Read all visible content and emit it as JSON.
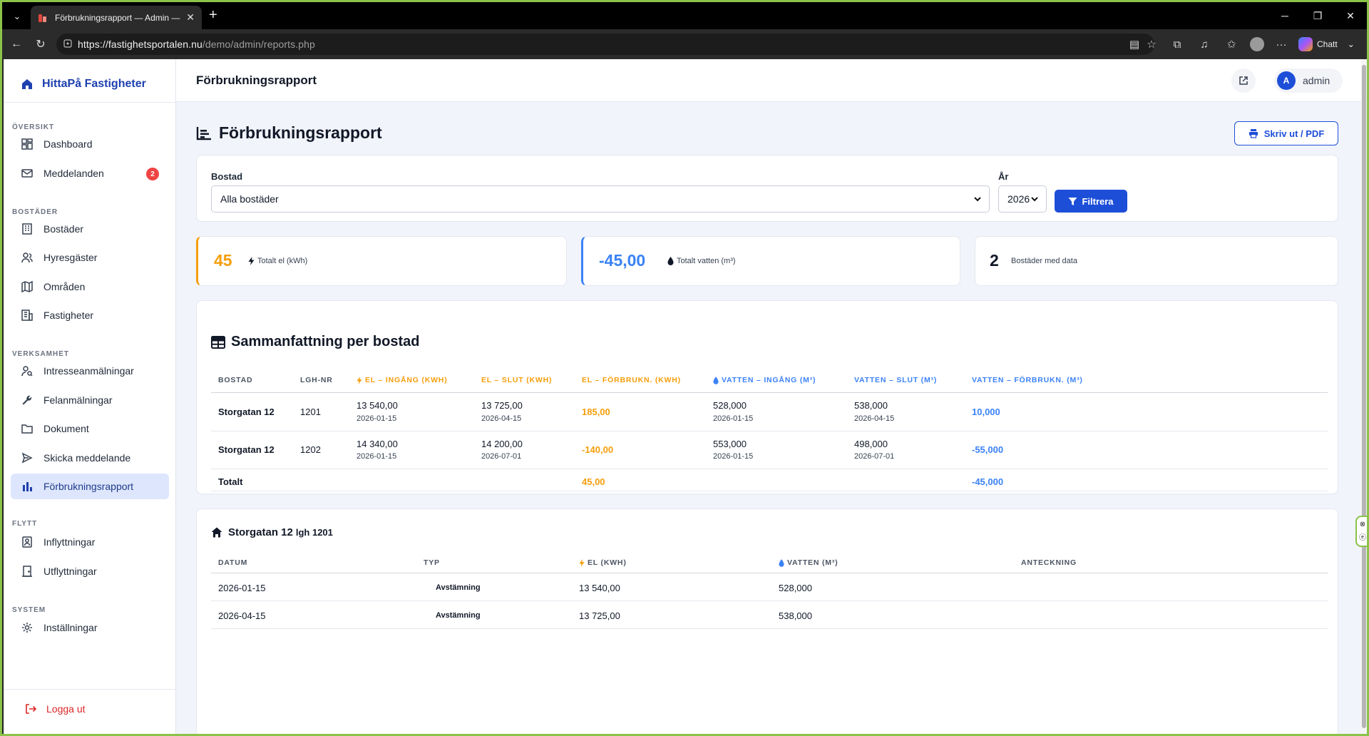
{
  "browser": {
    "tab_title": "Förbrukningsrapport — Admin —",
    "url_host": "https://fastighetsportalen.nu",
    "url_path": "/demo/admin/reports.php",
    "copilot_label": "Chatt"
  },
  "sidebar": {
    "brand": "HittaPå Fastigheter",
    "sections": {
      "overview": "ÖVERSIKT",
      "properties": "BOSTÄDER",
      "operations": "VERKSAMHET",
      "moving": "FLYTT",
      "system": "SYSTEM"
    },
    "items": {
      "dashboard": "Dashboard",
      "messages": "Meddelanden",
      "messages_badge": "2",
      "units": "Bostäder",
      "tenants": "Hyresgäster",
      "areas": "Områden",
      "buildings": "Fastigheter",
      "interest": "Intresseanmälningar",
      "fault_reports": "Felanmälningar",
      "documents": "Dokument",
      "send_message": "Skicka meddelande",
      "consumption_report": "Förbrukningsrapport",
      "move_ins": "Inflyttningar",
      "move_outs": "Utflyttningar",
      "settings": "Inställningar"
    },
    "logout": "Logga ut"
  },
  "header": {
    "title": "Förbrukningsrapport",
    "user_initial": "A",
    "user_name": "admin"
  },
  "page": {
    "title": "Förbrukningsrapport",
    "print_button": "Skriv ut / PDF"
  },
  "filter": {
    "unit_label": "Bostad",
    "unit_value": "Alla bostäder",
    "year_label": "År",
    "year_value": "2026",
    "filter_button": "Filtrera"
  },
  "stats": {
    "electricity_value": "45",
    "electricity_label": "Totalt el (kWh)",
    "water_value": "-45,00",
    "water_label": "Totalt vatten (m³)",
    "units_value": "2",
    "units_label": "Bostäder med data",
    "electricity_color": "#f59e0b",
    "water_color": "#3b82f6"
  },
  "summary": {
    "title": "Sammanfattning per bostad",
    "headers": {
      "unit": "BOSTAD",
      "apt_no": "LGH-NR",
      "el_in": "EL – INGÅNG (KWH)",
      "el_out": "EL – SLUT (KWH)",
      "el_use": "EL – FÖRBRUKN. (KWH)",
      "water_in": "VATTEN – INGÅNG (M³)",
      "water_out": "VATTEN – SLUT (M³)",
      "water_use": "VATTEN – FÖRBRUKN. (M³)"
    },
    "rows": [
      {
        "unit": "Storgatan 12",
        "apt_no": "1201",
        "el_in": "13 540,00",
        "el_in_date": "2026-01-15",
        "el_out": "13 725,00",
        "el_out_date": "2026-04-15",
        "el_use": "185,00",
        "water_in": "528,000",
        "water_in_date": "2026-01-15",
        "water_out": "538,000",
        "water_out_date": "2026-04-15",
        "water_use": "10,000"
      },
      {
        "unit": "Storgatan 12",
        "apt_no": "1202",
        "el_in": "14 340,00",
        "el_in_date": "2026-01-15",
        "el_out": "14 200,00",
        "el_out_date": "2026-07-01",
        "el_use": "-140,00",
        "water_in": "553,000",
        "water_in_date": "2026-01-15",
        "water_out": "498,000",
        "water_out_date": "2026-07-01",
        "water_use": "-55,000"
      }
    ],
    "total_label": "Totalt",
    "total_el": "45,00",
    "total_water": "-45,000"
  },
  "detail": {
    "title": "Storgatan 12",
    "apt_label": "lgh 1201",
    "headers": {
      "date": "DATUM",
      "type": "TYP",
      "el": "EL (KWH)",
      "water": "VATTEN (M³)",
      "note": "ANTECKNING"
    },
    "rows": [
      {
        "date": "2026-01-15",
        "type": "Avstämning",
        "el": "13 540,00",
        "water": "528,000",
        "note": ""
      },
      {
        "date": "2026-04-15",
        "type": "Avstämning",
        "el": "13 725,00",
        "water": "538,000",
        "note": ""
      }
    ]
  }
}
